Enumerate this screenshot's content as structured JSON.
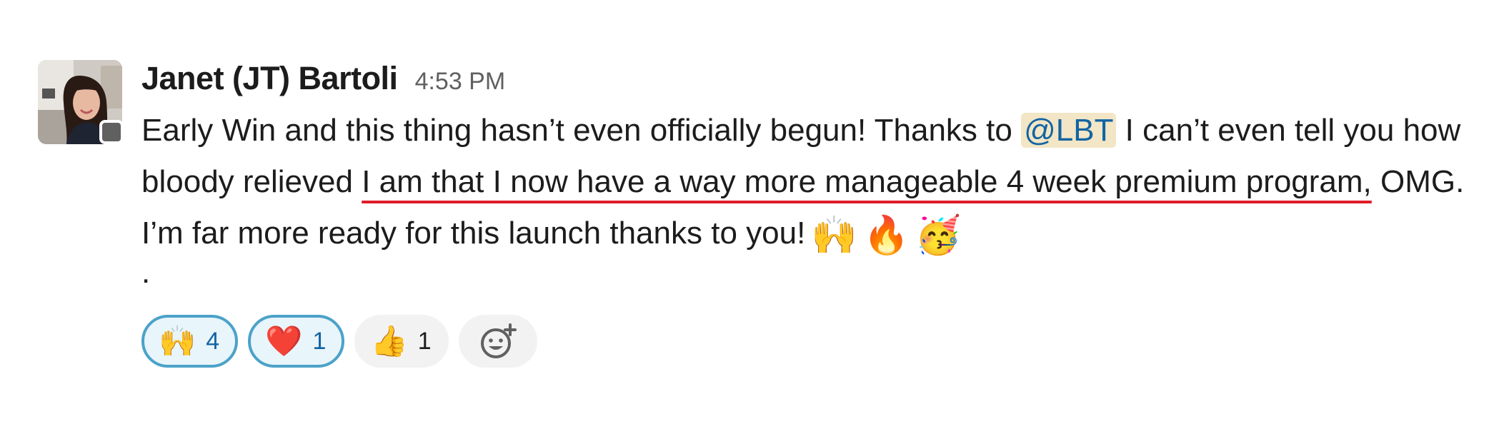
{
  "message": {
    "author": "Janet (JT) Bartoli",
    "timestamp": "4:53 PM",
    "text_part1": "Early Win and this thing hasn’t even officially begun! Thanks to ",
    "mention": "@LBT",
    "text_part2": " I can’t even tell you how bloody relieved ",
    "underlined_text": "I am that I now have a way more manageable 4 week premium program,",
    "text_part3": " OMG. I’m far more ready for this launch thanks to you!",
    "trailing": ".",
    "emojis": [
      {
        "name": "raised-hands-icon",
        "glyph": "🙌"
      },
      {
        "name": "fire-icon",
        "glyph": "🔥"
      },
      {
        "name": "partying-face-icon",
        "glyph": "🥳"
      }
    ]
  },
  "reactions": [
    {
      "name": "raised-hands-icon",
      "glyph": "🙌",
      "count": "4",
      "active": true
    },
    {
      "name": "heart-icon",
      "glyph": "❤️",
      "count": "1",
      "active": true
    },
    {
      "name": "thumbs-up-icon",
      "glyph": "👍",
      "count": "1",
      "active": false
    }
  ],
  "colors": {
    "mention_text": "#1264a3",
    "mention_bg": "#f2e6c6",
    "underline": "#e01e29",
    "reaction_active_border": "#4ba2c9"
  }
}
